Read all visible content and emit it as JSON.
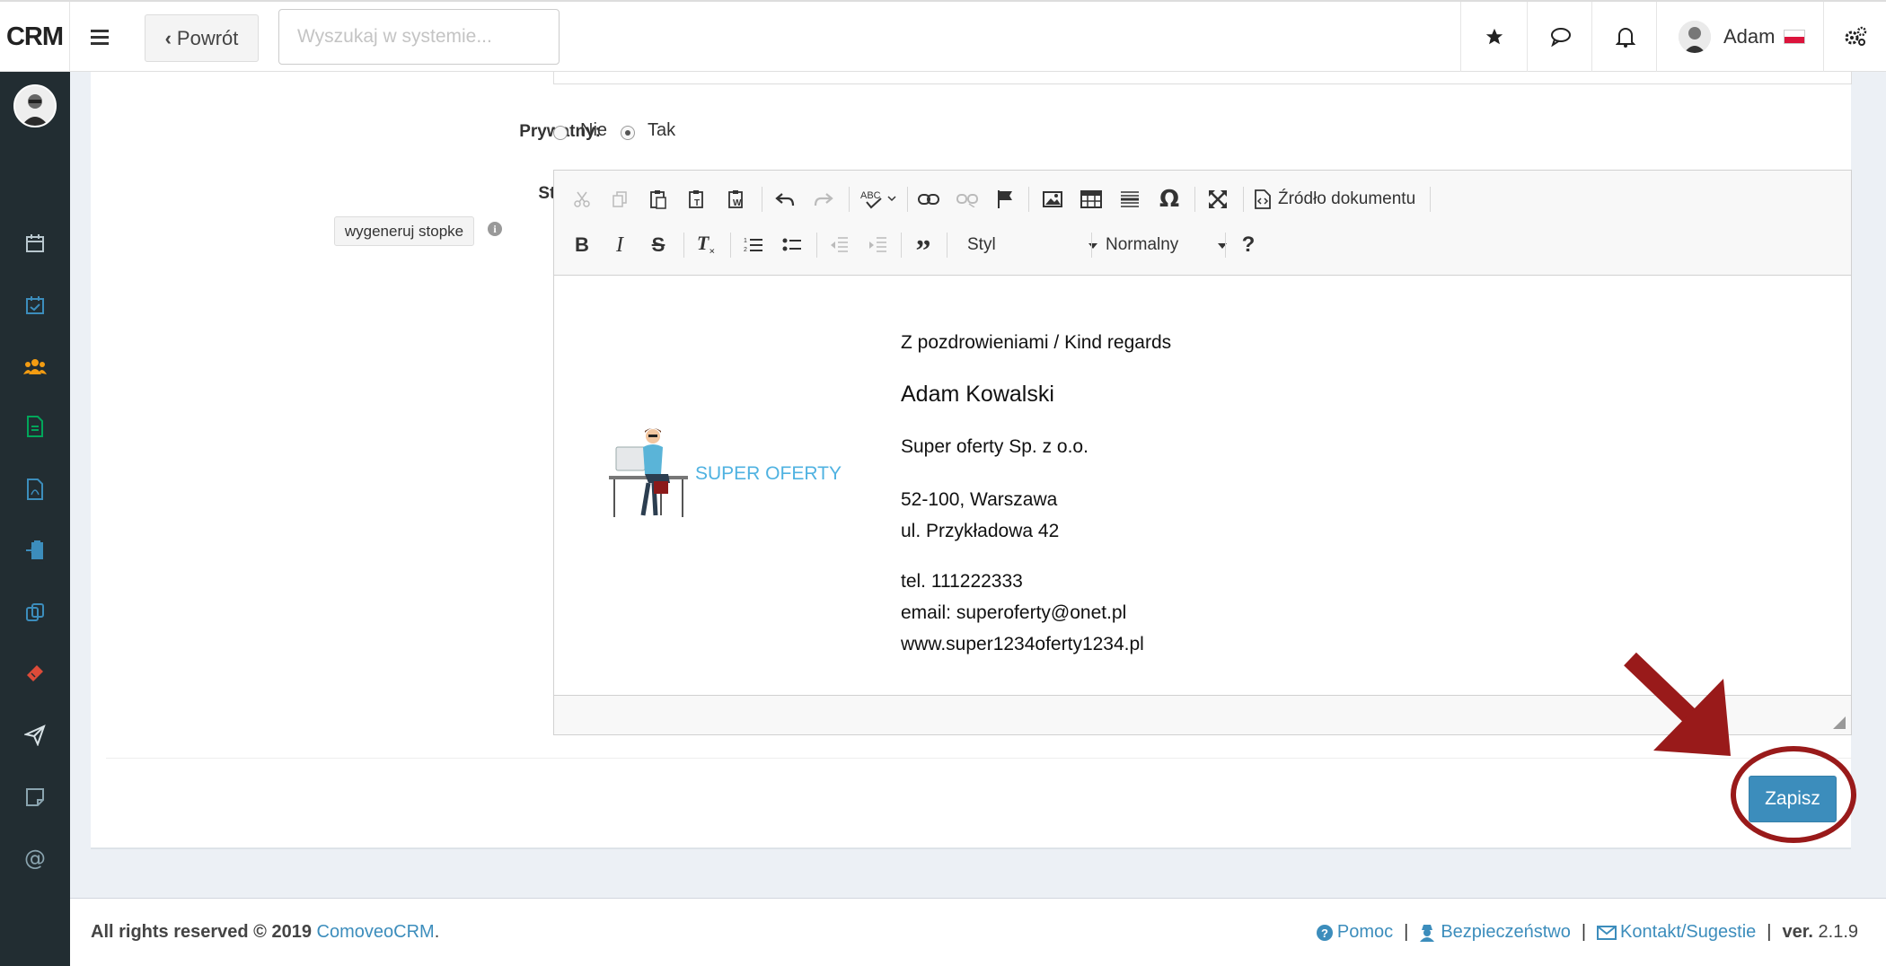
{
  "header": {
    "brand": "CRM",
    "back_label": "Powrót",
    "search_placeholder": "Wyszukaj w systemie...",
    "user_name": "Adam"
  },
  "sidebar": {
    "items": [
      "calendar-icon",
      "calendar-check-icon",
      "users-icon",
      "document-icon",
      "pdf-icon",
      "clipboard-icon",
      "copy-icon",
      "ticket-icon",
      "send-icon",
      "note-icon",
      "at-icon"
    ],
    "accent_colors": {
      "blue": "#3c8dbc",
      "orange": "#f39c12",
      "green": "#00a65a",
      "red": "#dd4b39"
    }
  },
  "form": {
    "private_label": "Prywatny:",
    "radio_no": "Nie",
    "radio_yes": "Tak",
    "private_selected": "Tak",
    "footer_label": "Stopka:",
    "generate_button": "wygeneruj stopke"
  },
  "editor": {
    "source_button": "Źródło dokumentu",
    "style_combo": "Styl",
    "format_combo": "Normalny",
    "help": "?",
    "logo_text": "SUPER OFERTY",
    "signature": {
      "greeting": "Z pozdrowieniami / Kind regards",
      "name": "Adam Kowalski",
      "company": "Super oferty Sp. z o.o.",
      "address1": "52-100, Warszawa",
      "address2": "ul. Przykładowa 42",
      "phone": "tel. 111222333",
      "email": "email: superoferty@onet.pl",
      "www": "www.super1234oferty1234.pl"
    }
  },
  "save_button": "Zapisz",
  "footer": {
    "rights": "All rights reserved © 2019",
    "brand_link": "ComoveoCRM",
    "help": "Pomoc",
    "security": "Bezpieczeństwo",
    "contact": "Kontakt/Sugestie",
    "version_label": "ver.",
    "version": "2.1.9"
  }
}
